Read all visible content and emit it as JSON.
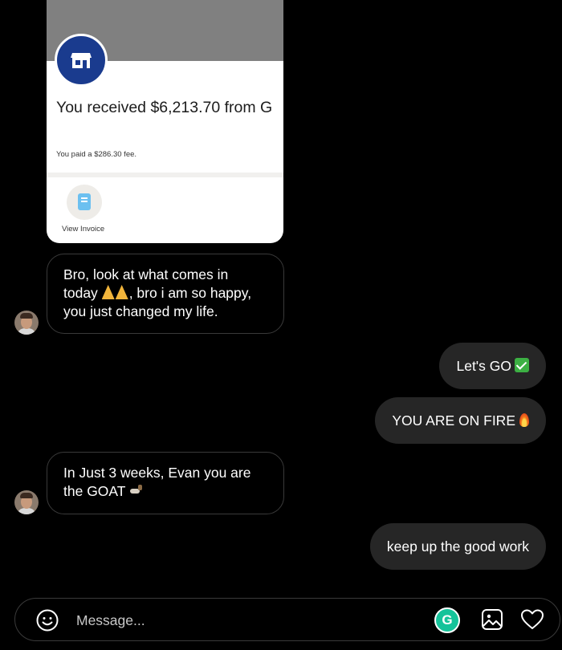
{
  "shared_card": {
    "received_text": "You received $6,213.70 from G",
    "fee_text": "You paid a $286.30 fee.",
    "view_invoice_label": "View Invoice",
    "avatar_icon": "store-icon",
    "invoice_icon": "invoice-icon",
    "brand_color": "#1a3b8e"
  },
  "messages": {
    "incoming_1": {
      "line_1": "Bro, look at what comes in",
      "line_2_before": "today",
      "line_2_after": ", bro i am so happy,",
      "line_3": "you just changed my life.",
      "emoji": "folded-hands-icon"
    },
    "outgoing_1": {
      "text": "Let's GO",
      "emoji": "check-mark-icon"
    },
    "outgoing_2": {
      "text": "YOU ARE ON FIRE",
      "emoji": "fire-icon"
    },
    "incoming_2": {
      "line_1": "In Just 3 weeks, Evan you are",
      "line_2": "the GOAT",
      "emoji": "goat-icon"
    },
    "outgoing_3": {
      "text": "keep up the good work"
    }
  },
  "composer": {
    "placeholder": "Message...",
    "emoji_icon": "smiley-icon",
    "grammarly_label": "G",
    "image_icon": "image-icon",
    "like_icon": "heart-icon"
  },
  "colors": {
    "background": "#000000",
    "outgoing_bubble": "#262626",
    "incoming_border": "#3a3a3a",
    "grammarly": "#15c39a"
  }
}
